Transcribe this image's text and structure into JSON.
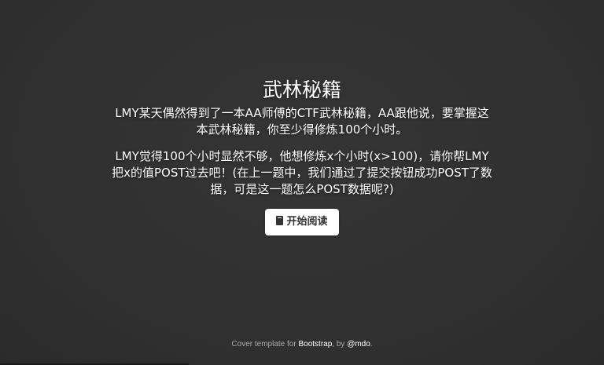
{
  "main": {
    "heading": "武林秘籍",
    "lead1": "LMY某天偶然得到了一本AA师傅的CTF武林秘籍，AA跟他说，要掌握这本武林秘籍，你至少得修炼100个小时。",
    "lead2": "LMY觉得100个小时显然不够，他想修炼x个小时(x>100)，请你帮LMY把x的值POST过去吧！(在上一题中，我们通过了提交按钮成功POST了数据，可是这一题怎么POST数据呢?)",
    "button_label": "开始阅读",
    "button_icon": "book-icon"
  },
  "footer": {
    "prefix": "Cover template for ",
    "bootstrap_link": "Bootstrap",
    "middle": ", by ",
    "mdo_link": "@mdo",
    "suffix": "."
  }
}
